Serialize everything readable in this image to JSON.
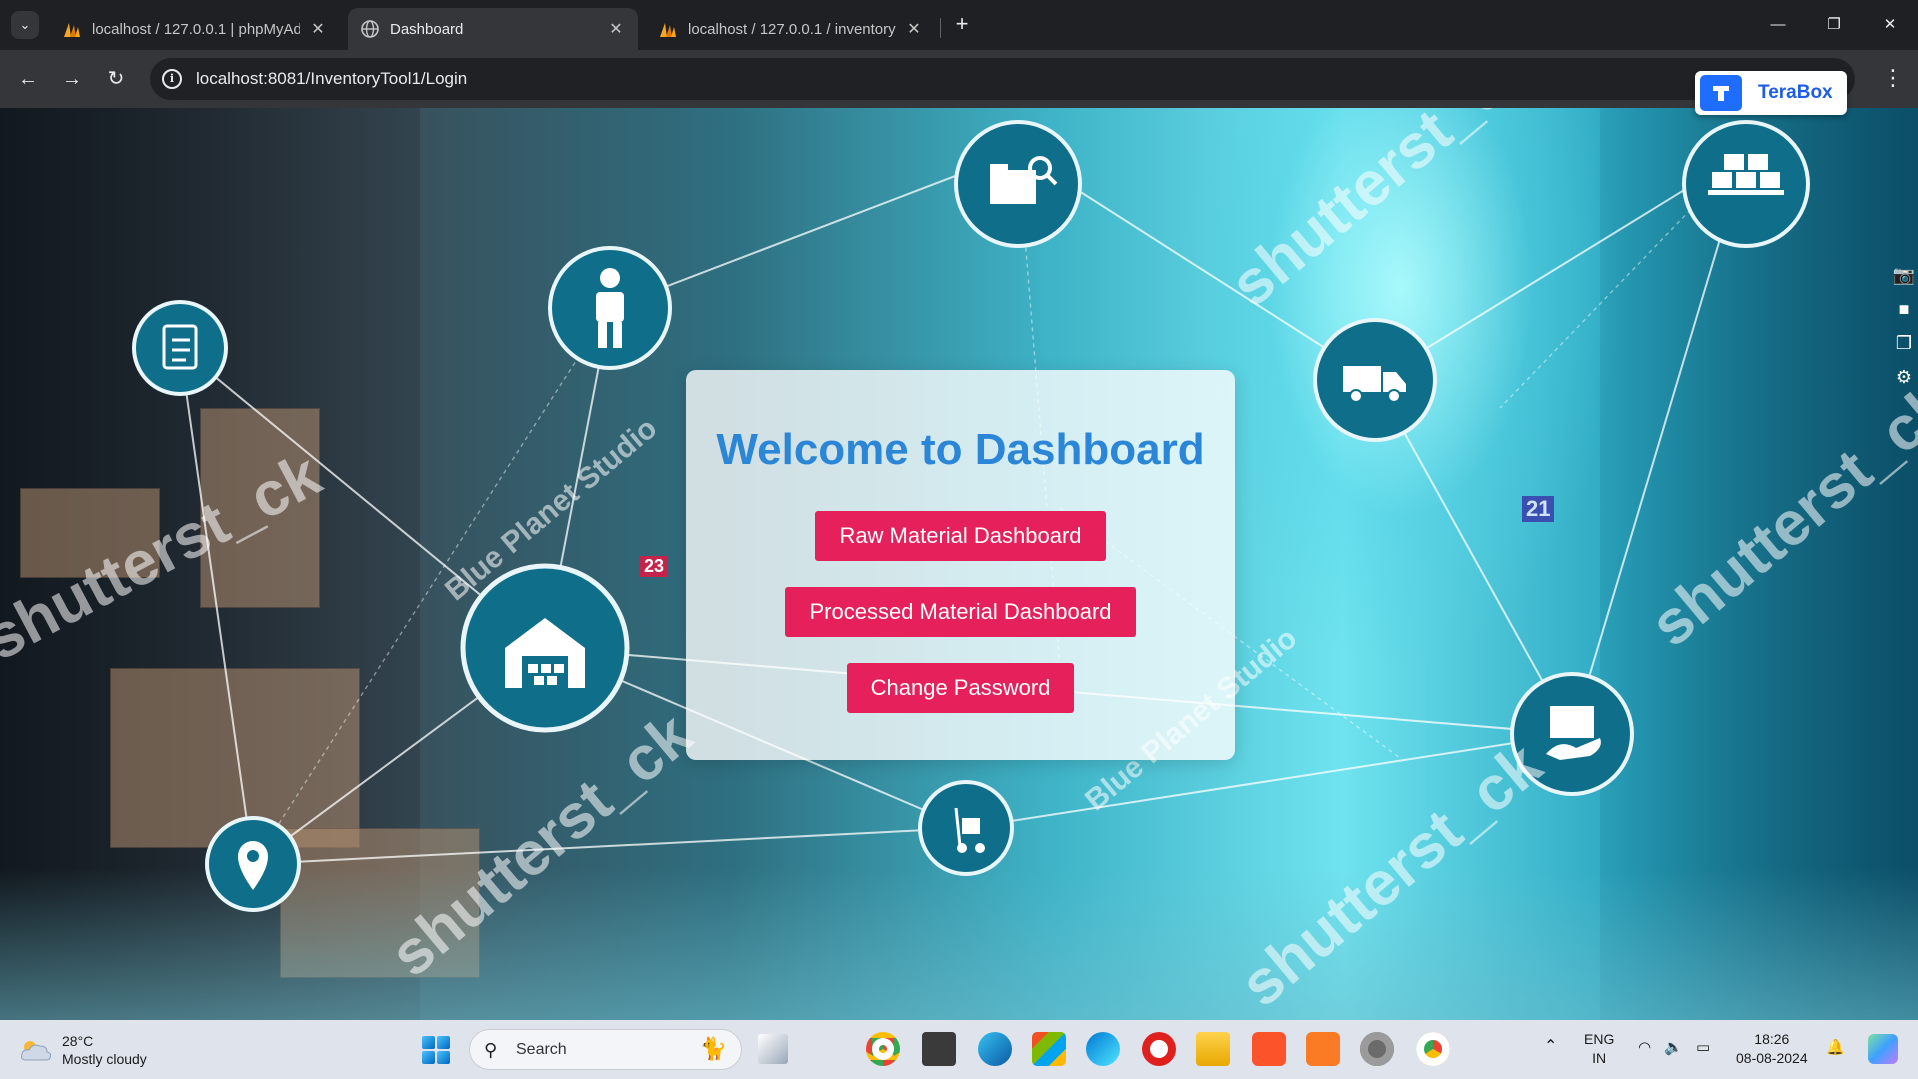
{
  "browser": {
    "tabs": [
      {
        "title": "localhost / 127.0.0.1 | phpMyAd",
        "active": false,
        "favicon": "phpmyadmin-icon"
      },
      {
        "title": "Dashboard",
        "active": true,
        "favicon": "globe-icon"
      },
      {
        "title": "localhost / 127.0.0.1 / inventory",
        "active": false,
        "favicon": "phpmyadmin-icon"
      }
    ],
    "url": "localhost:8081/InventoryTool1/Login",
    "extension_label": "TeraBox"
  },
  "page": {
    "heading": "Welcome to Dashboard",
    "buttons": {
      "raw": "Raw Material Dashboard",
      "processed": "Processed Material Dashboard",
      "password": "Change Password"
    },
    "colors": {
      "heading": "#2b86d8",
      "button": "#e6205a"
    },
    "background_watermarks": [
      "shutterst_ck",
      "Blue Planet Studio",
      "23",
      "21"
    ]
  },
  "taskbar": {
    "temperature": "28°C",
    "weather": "Mostly cloudy",
    "search_label": "Search",
    "language": "ENG",
    "region": "IN",
    "time": "18:26",
    "date": "08-08-2024"
  }
}
